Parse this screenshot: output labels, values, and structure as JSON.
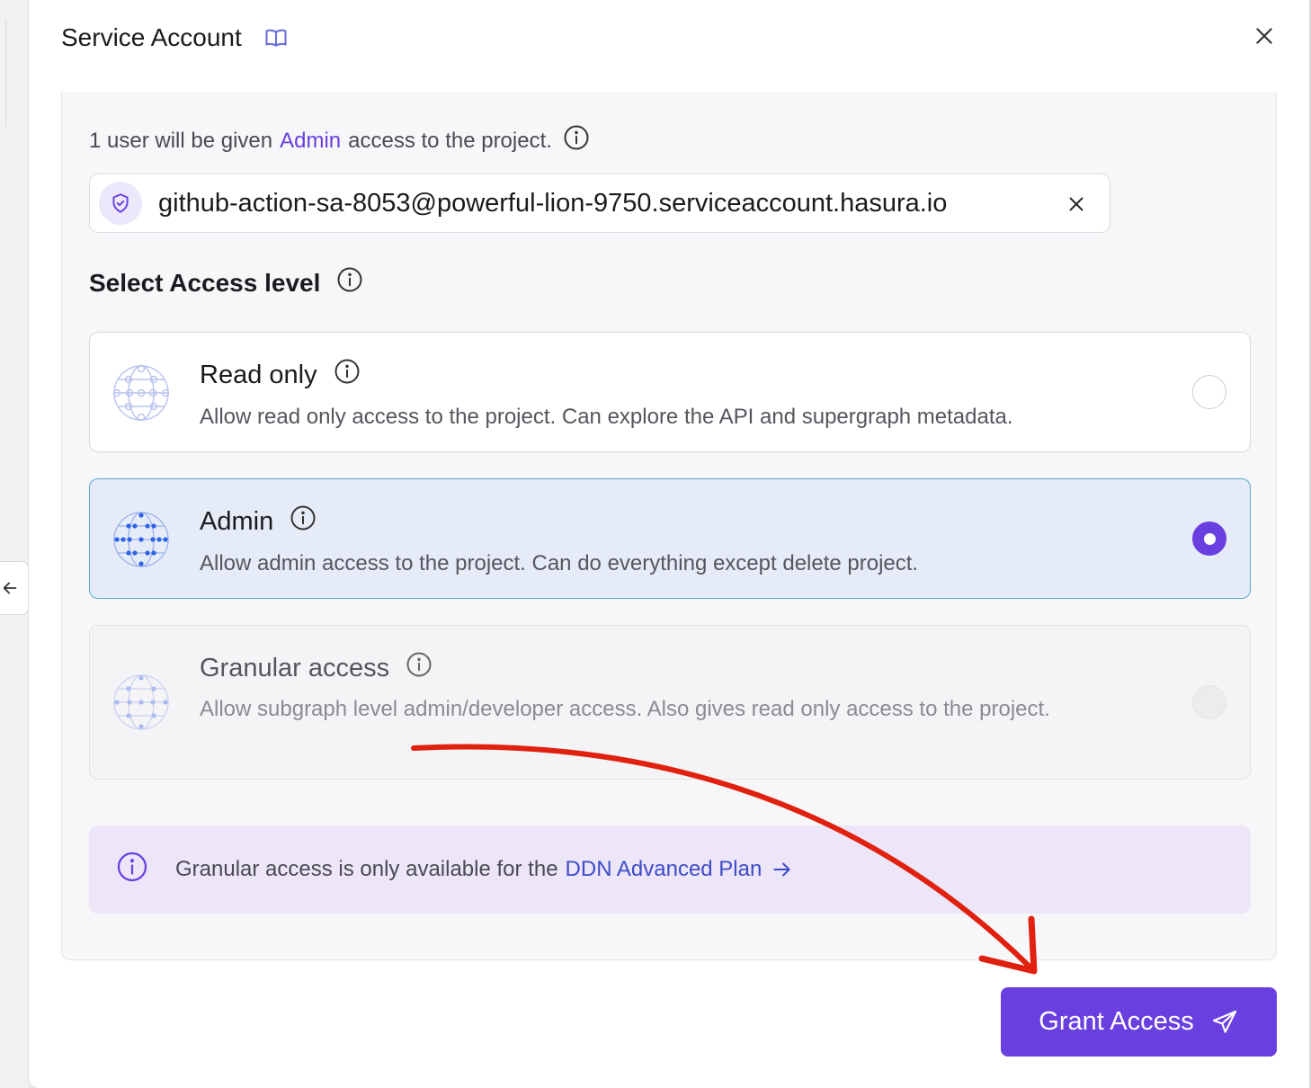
{
  "dialog": {
    "title": "Service Account",
    "docs_icon": "book-icon",
    "close_icon": "close-icon"
  },
  "summary": {
    "prefix": "1 user will be given",
    "role": "Admin",
    "suffix": "access to the project."
  },
  "user_chip": {
    "email": "github-action-sa-8053@powerful-lion-9750.serviceaccount.hasura.io",
    "icon": "shield-icon",
    "remove_icon": "close-icon"
  },
  "access_section": {
    "title": "Select Access level"
  },
  "access_levels": [
    {
      "name": "Read only",
      "description": "Allow read only access to the project. Can explore the API and supergraph metadata.",
      "selected": false,
      "disabled": false
    },
    {
      "name": "Admin",
      "description": "Allow admin access to the project. Can do everything except delete project.",
      "selected": true,
      "disabled": false
    },
    {
      "name": "Granular access",
      "description": "Allow subgraph level admin/developer access. Also gives read only access to the project.",
      "selected": false,
      "disabled": true
    }
  ],
  "notice": {
    "text": "Granular access is only available for the",
    "link": "DDN Advanced Plan"
  },
  "actions": {
    "grant_label": "Grant Access",
    "grant_icon": "send-icon"
  },
  "colors": {
    "accent": "#6a3fe0",
    "selected_bg": "#e5ecf8",
    "selected_border": "#5aa9cf",
    "notice_bg": "#ece6f8",
    "link": "#3f4bc8",
    "annotation_arrow": "#e0210f"
  }
}
